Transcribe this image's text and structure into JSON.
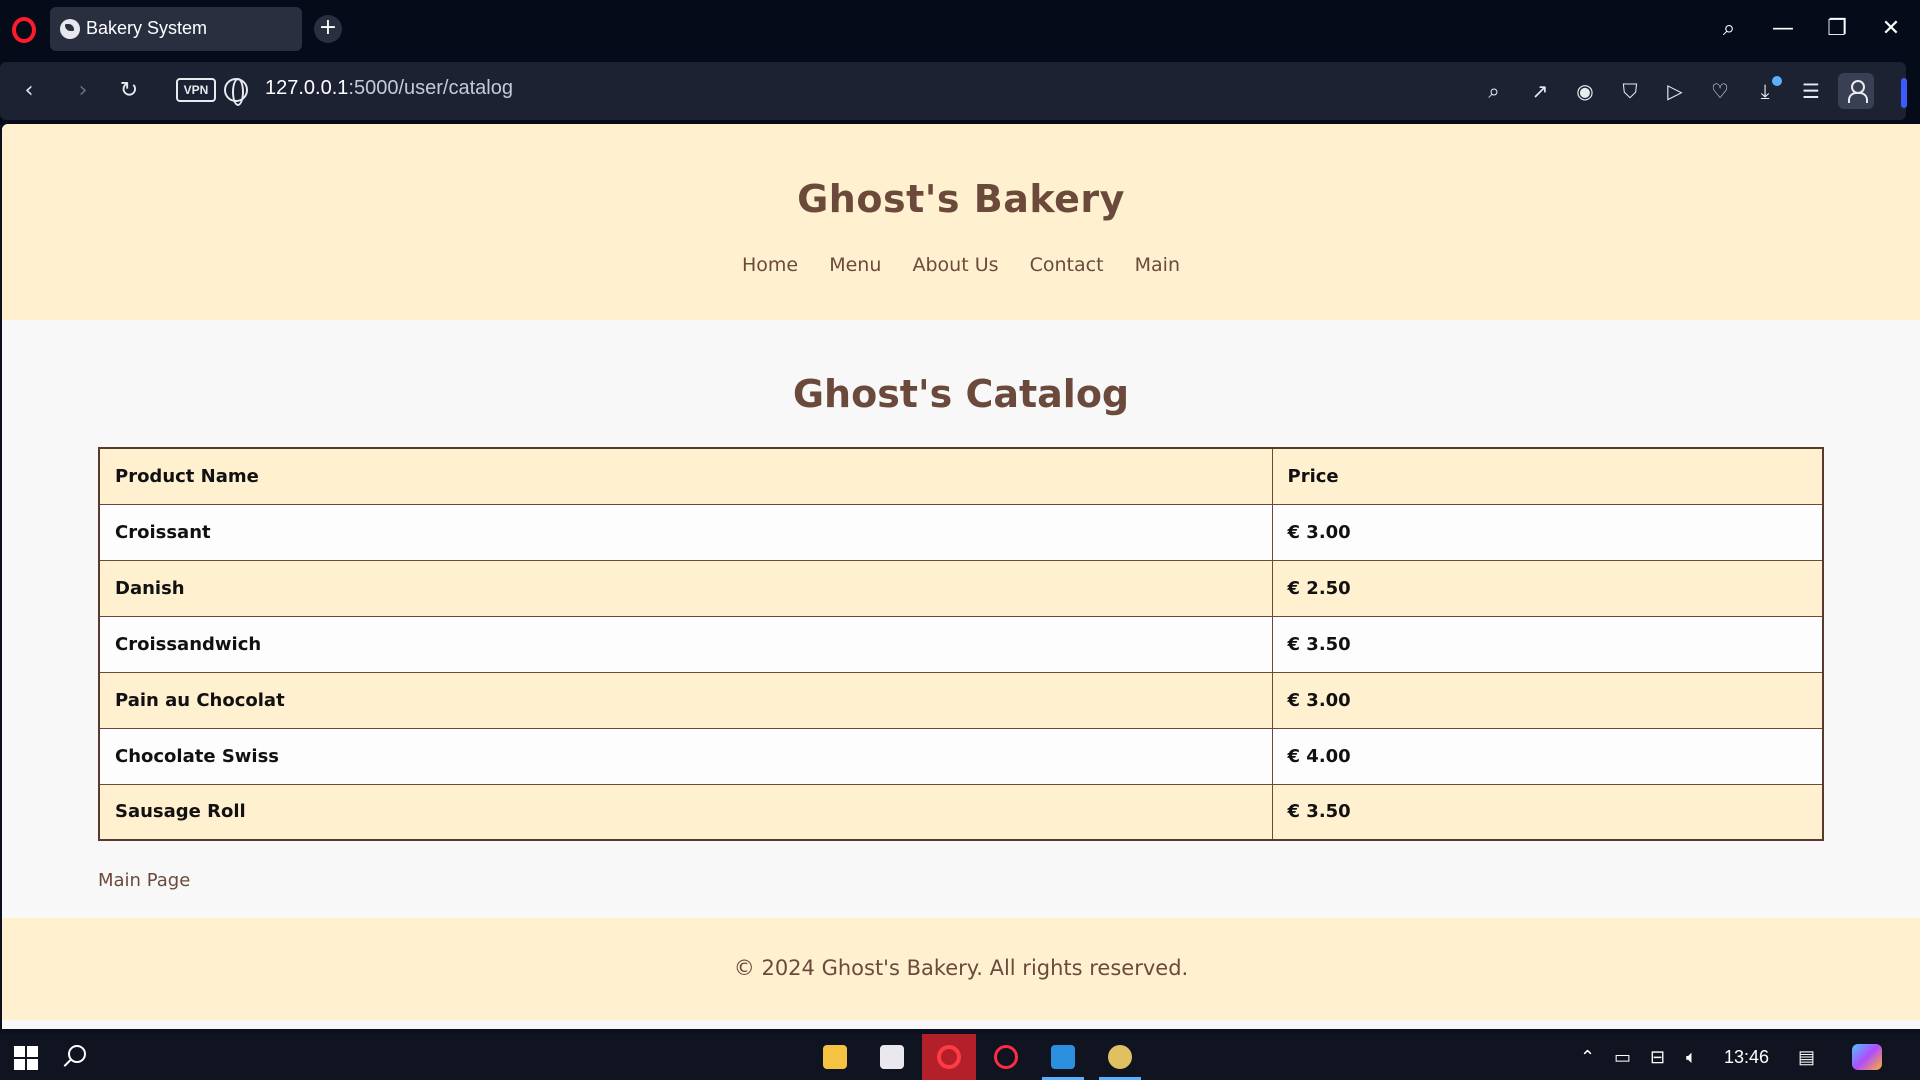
{
  "browser": {
    "tab_title": "Bakery System",
    "url_host": "127.0.0.1",
    "url_path": ":5000/user/catalog",
    "vpn_label": "VPN"
  },
  "site": {
    "title": "Ghost's Bakery",
    "nav": [
      "Home",
      "Menu",
      "About Us",
      "Contact",
      "Main"
    ]
  },
  "catalog": {
    "heading": "Ghost's Catalog",
    "columns": [
      "Product Name",
      "Price"
    ],
    "rows": [
      {
        "name": "Croissant",
        "price": "€ 3.00"
      },
      {
        "name": "Danish",
        "price": "€ 2.50"
      },
      {
        "name": "Croissandwich",
        "price": "€ 3.50"
      },
      {
        "name": "Pain au Chocolat",
        "price": "€ 3.00"
      },
      {
        "name": "Chocolate Swiss",
        "price": "€ 4.00"
      },
      {
        "name": "Sausage Roll",
        "price": "€ 3.50"
      }
    ],
    "main_page_link": "Main Page"
  },
  "footer": {
    "text": "© 2024 Ghost's Bakery. All rights reserved."
  },
  "taskbar": {
    "time": "13:46",
    "apps": [
      "file-explorer-icon",
      "microsoft-store-icon",
      "opera-browser-icon",
      "opera-gx-icon",
      "vscode-icon",
      "paint-icon"
    ]
  },
  "colors": {
    "brand_brown": "#6b4a3c",
    "cream": "#fff0d0",
    "browser_dark": "#060b1a"
  }
}
